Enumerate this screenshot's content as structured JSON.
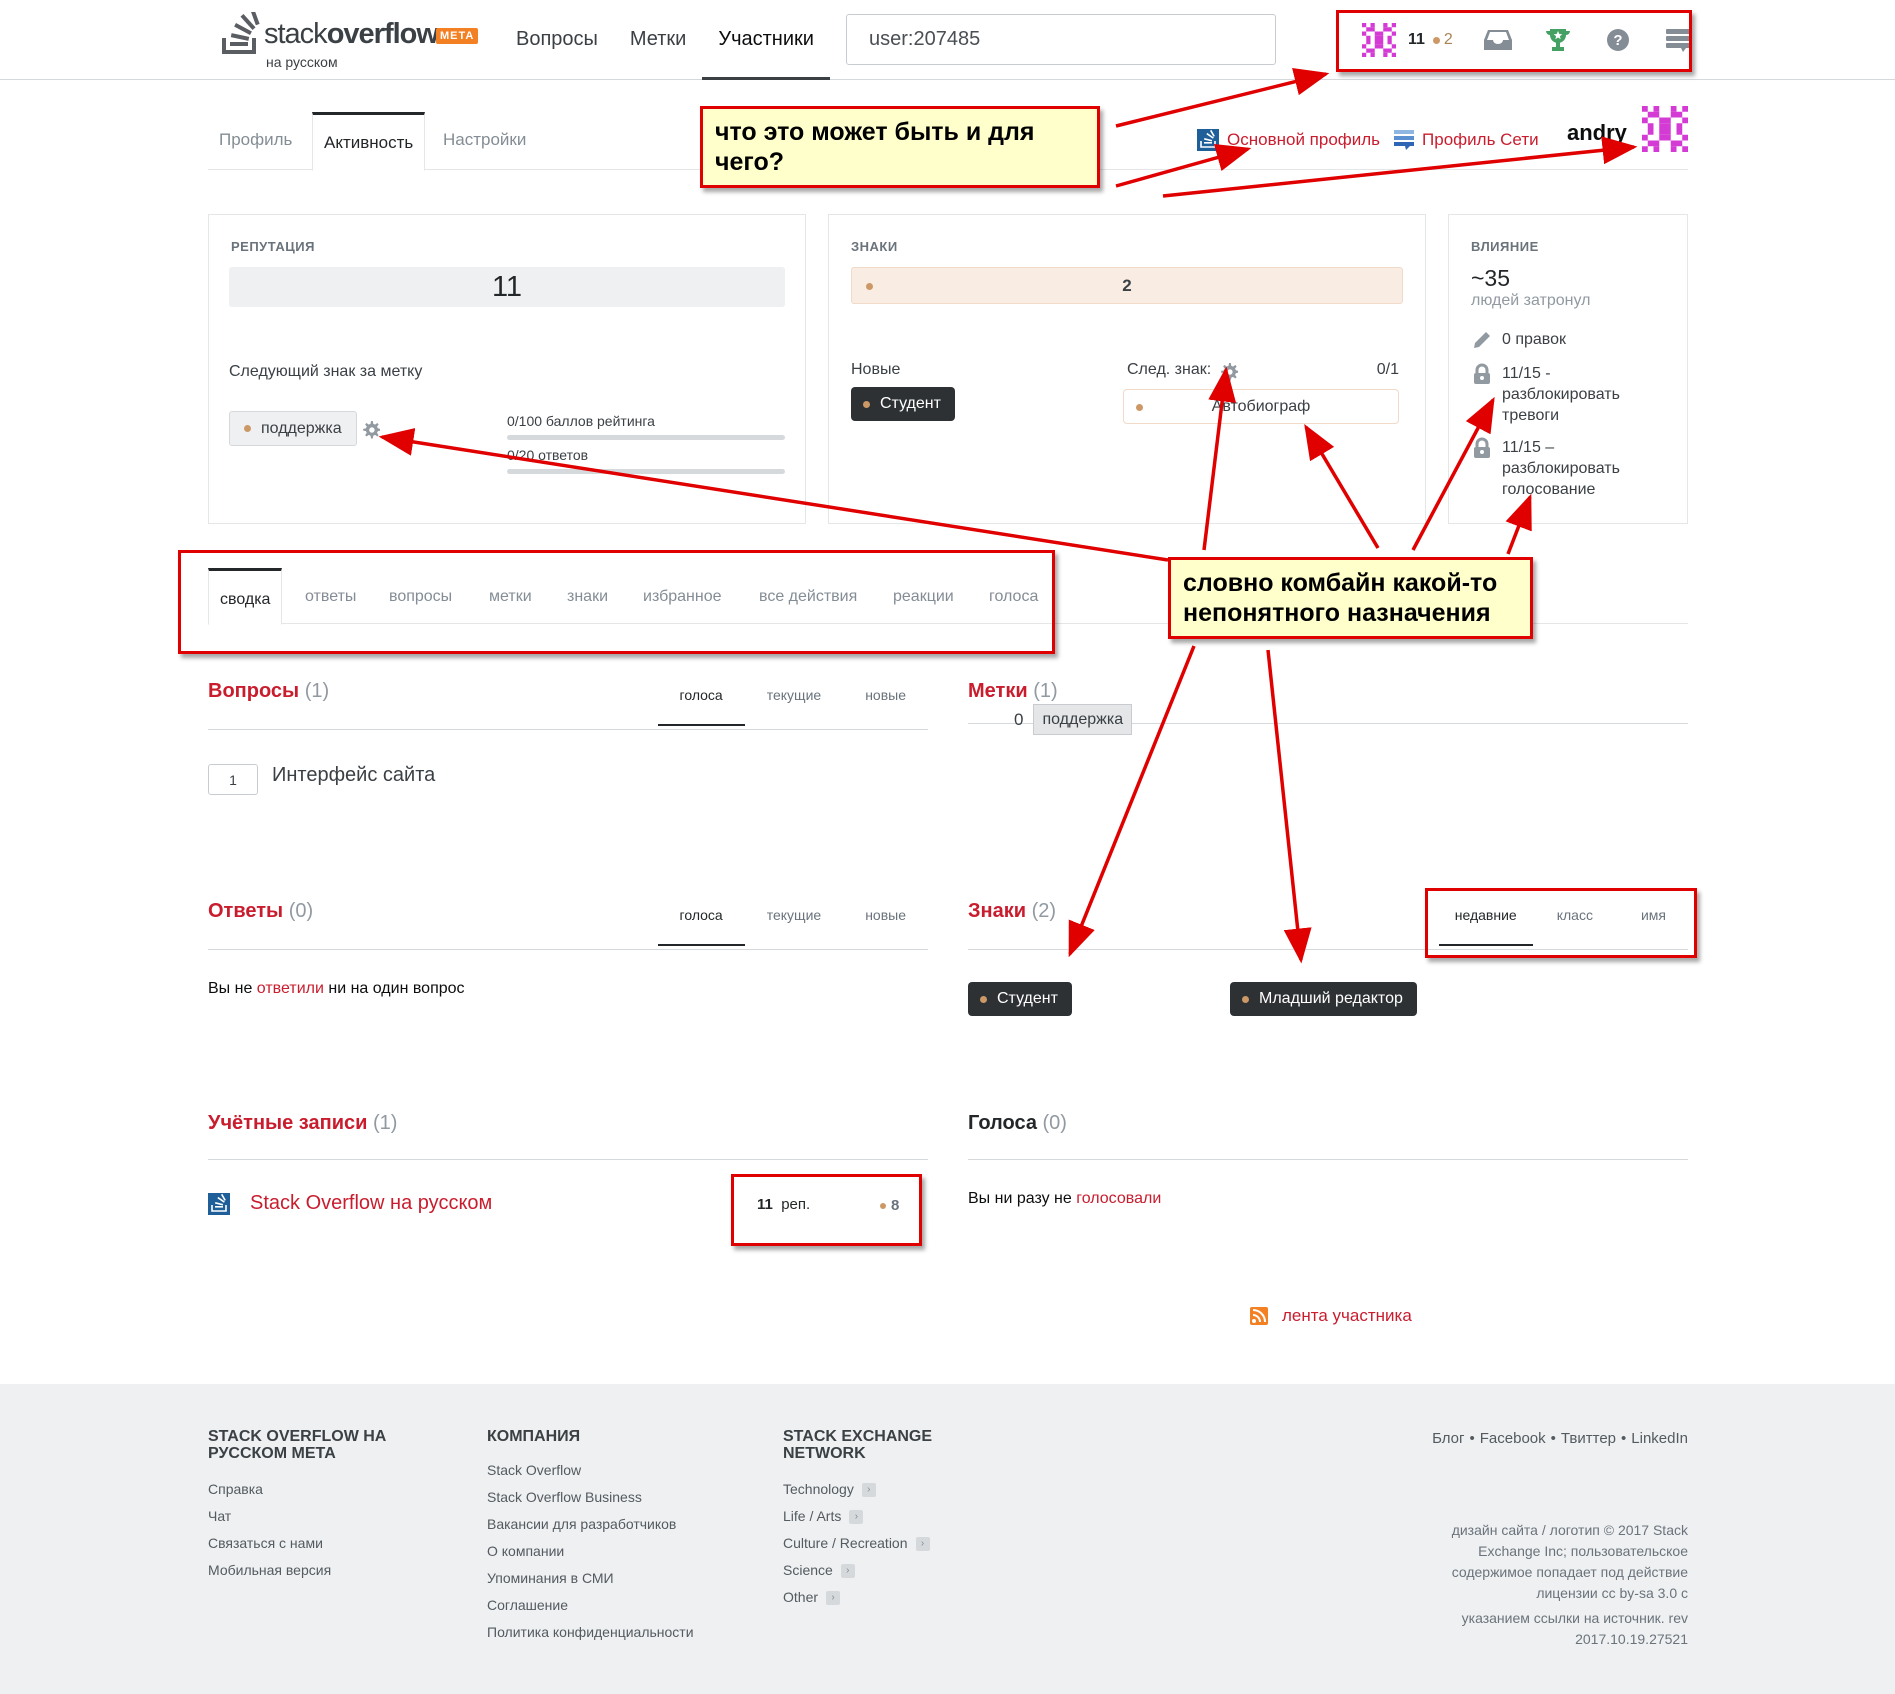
{
  "topbar": {
    "logo_word_light": "stack",
    "logo_word_bold": "overflow",
    "logo_sub": "на русском",
    "logo_meta": "META",
    "nav": [
      {
        "label": "Вопросы",
        "active": false
      },
      {
        "label": "Метки",
        "active": false
      },
      {
        "label": "Участники",
        "active": true
      }
    ],
    "search_value": "user:207485",
    "reputation": "11",
    "bronze_badges": "2",
    "icons": [
      "inbox-icon",
      "achievements-icon",
      "help-icon",
      "site-switcher-icon"
    ]
  },
  "profile_tabs": [
    {
      "label": "Профиль",
      "active": false
    },
    {
      "label": "Активность",
      "active": true
    },
    {
      "label": "Настройки",
      "active": false
    }
  ],
  "profile_links": {
    "main_profile": "Основной профиль",
    "network_profile": "Профиль Сети",
    "username": "andry"
  },
  "reputation_card": {
    "title": "РЕПУТАЦИЯ",
    "value": "11",
    "next_tag_badge_label": "Следующий знак за метку",
    "tag": "поддержка",
    "progress": [
      {
        "label": "0/100 баллов рейтинга",
        "fraction": 0
      },
      {
        "label": "0/20 ответов",
        "fraction": 0
      }
    ]
  },
  "badges_card": {
    "title": "ЗНАКИ",
    "bronze_count": "2",
    "new_label": "Новые",
    "new_badge": "Студент",
    "next_label": "След. знак:",
    "next_progress": "0/1",
    "next_badge": "Автобиограф"
  },
  "impact_card": {
    "title": "ВЛИЯНИЕ",
    "reach": "~35",
    "reach_label": "людей затронул",
    "edits": "0 правок",
    "flags": [
      "11/15 -",
      "разблокировать",
      "тревоги"
    ],
    "votes": [
      "11/15 –",
      "разблокировать",
      "голосование"
    ]
  },
  "activity_tabs": [
    {
      "label": "сводка",
      "active": true
    },
    {
      "label": "ответы",
      "active": false
    },
    {
      "label": "вопросы",
      "active": false
    },
    {
      "label": "метки",
      "active": false
    },
    {
      "label": "знаки",
      "active": false
    },
    {
      "label": "избранное",
      "active": false
    },
    {
      "label": "все действия",
      "active": false
    },
    {
      "label": "реакции",
      "active": false
    },
    {
      "label": "голоса",
      "active": false
    }
  ],
  "questions": {
    "title": "Вопросы",
    "count": "(1)",
    "sort": [
      "голоса",
      "текущие",
      "новые"
    ],
    "items": [
      {
        "votes": "1",
        "title": "Интерфейс сайта"
      }
    ]
  },
  "tags": {
    "title": "Метки",
    "count": "(1)",
    "items": [
      {
        "score": "0",
        "name": "поддержка"
      }
    ]
  },
  "answers": {
    "title": "Ответы",
    "count": "(0)",
    "sort": [
      "голоса",
      "текущие",
      "новые"
    ],
    "empty_pre": "Вы не ",
    "empty_link": "ответили",
    "empty_post": " ни на один вопрос"
  },
  "badges": {
    "title": "Знаки",
    "count": "(2)",
    "sort": [
      "недавние",
      "класс",
      "имя"
    ],
    "items": [
      "Студент",
      "Младший редактор"
    ]
  },
  "accounts": {
    "title": "Учётные записи",
    "count": "(1)",
    "items": [
      {
        "name": "Stack Overflow на русском",
        "rep": "11",
        "rep_suffix": "реп.",
        "bronze": "8"
      }
    ]
  },
  "votes": {
    "title": "Голоса",
    "count": "(0)",
    "empty_pre": "Вы ни разу не ",
    "empty_link": "голосовали"
  },
  "feed_link": "лента участника",
  "footer": {
    "col1_title": "STACK OVERFLOW НА РУССКОМ МЕТА",
    "col1_links": [
      "Справка",
      "Чат",
      "Связаться с нами",
      "Мобильная версия"
    ],
    "col2_title": "КОМПАНИЯ",
    "col2_links": [
      "Stack Overflow",
      "Stack Overflow Business",
      "Вакансии для разработчиков",
      "О компании",
      "Упоминания в СМИ",
      "Соглашение",
      "Политика конфиденциальности"
    ],
    "col3_title": "STACK EXCHANGE NETWORK",
    "col3_links": [
      "Technology",
      "Life / Arts",
      "Culture / Recreation",
      "Science",
      "Other"
    ],
    "social": [
      "Блог",
      "Facebook",
      "Твиттер",
      "LinkedIn"
    ],
    "copyright": [
      "дизайн сайта / логотип © 2017 Stack",
      "Exchange Inc; пользовательское",
      "содержимое попадает под действие",
      "лицензии cc by-sa 3.0 с",
      "указанием ссылки на источник. rev",
      "2017.10.19.27521"
    ]
  },
  "annotations": {
    "note1": "что это может быть и для чего?",
    "note2": "словно комбайн какой-то непонятного назначения",
    "color": "#e00000"
  },
  "colors": {
    "accent_red": "#c91d2e",
    "bronze": "#cc9966",
    "meta_orange": "#f48024"
  }
}
